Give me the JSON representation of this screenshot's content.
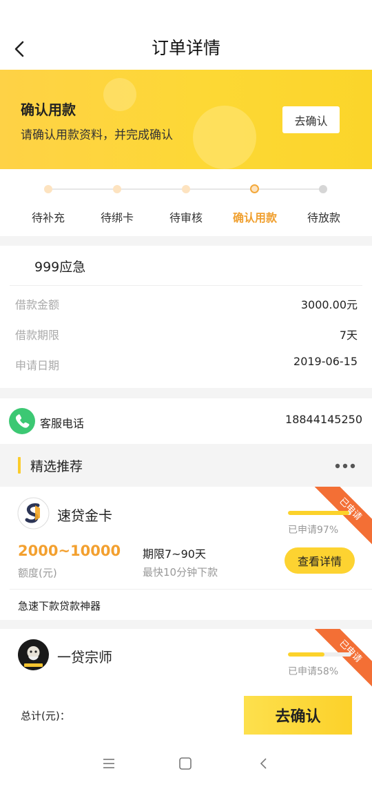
{
  "header": {
    "title": "订单详情"
  },
  "banner": {
    "title": "确认用款",
    "subtitle": "请确认用款资料，并完成确认",
    "button_label": "去确认"
  },
  "steps": [
    {
      "label": "待补充"
    },
    {
      "label": "待绑卡"
    },
    {
      "label": "待审核"
    },
    {
      "label": "确认用款"
    },
    {
      "label": "待放款"
    }
  ],
  "order": {
    "name": "999应急",
    "rows": [
      {
        "label": "借款金额",
        "value": "3000.00元"
      },
      {
        "label": "借款期限",
        "value": "7天"
      },
      {
        "label": "申请日期",
        "value": "2019-06-15"
      }
    ]
  },
  "service": {
    "label": "客服电话",
    "phone": "18844145250"
  },
  "recommend": {
    "title": "精选推荐",
    "products": [
      {
        "name": "速贷金卡",
        "ribbon": "已申请",
        "progress": 0.97,
        "applied_text": "已申请97%",
        "amount": "2000~10000",
        "amount_label": "额度(元)",
        "term": "期限7~90天",
        "speed": "最快10分钟下款",
        "detail_label": "查看详情",
        "slogan": "急速下款贷款神器"
      },
      {
        "name": "一贷宗师",
        "ribbon": "已申请",
        "progress": 0.58,
        "applied_text": "已申请58%"
      }
    ]
  },
  "footer": {
    "total_label": "总计(元)：",
    "confirm_label": "去确认"
  },
  "colors": {
    "accent": "#fdd331",
    "highlight": "#f3a02f",
    "ribbon": "#f36f35",
    "phone": "#3cc873"
  }
}
